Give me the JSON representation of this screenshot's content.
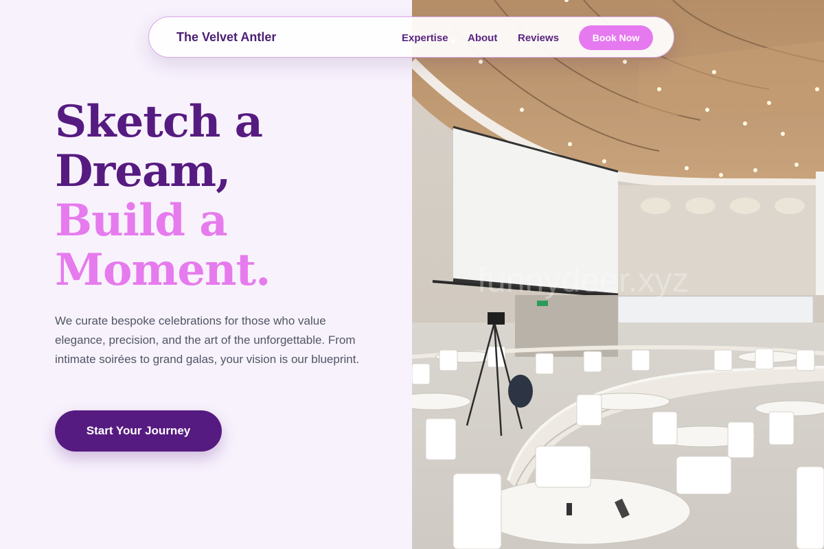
{
  "nav": {
    "brand": "The Velvet Antler",
    "links": [
      "Expertise",
      "About",
      "Reviews"
    ],
    "cta": "Book Now"
  },
  "hero": {
    "title_lines_dark": [
      "Sketch a",
      "Dream,"
    ],
    "title_lines_pink": [
      "Build a",
      "Moment."
    ],
    "description": "We curate bespoke celebrations for those who value elegance, precision, and the art of the unforgettable. From intimate soirées to grand galas, your vision is our blueprint.",
    "cta": "Start Your Journey"
  },
  "image": {
    "watermark": "funnydeer.xyz"
  },
  "colors": {
    "background": "#f8f2fd",
    "primary": "#561b80",
    "accent": "#e67bed",
    "text": "#4f5662"
  }
}
